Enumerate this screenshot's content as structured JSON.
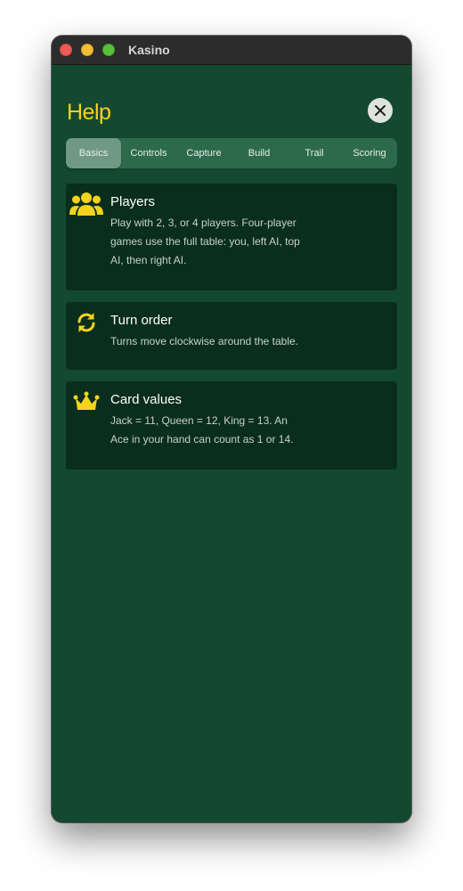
{
  "window": {
    "title": "Kasino"
  },
  "help": {
    "title": "Help",
    "close_icon": "close-icon"
  },
  "tabs": [
    {
      "label": "Basics",
      "active": true
    },
    {
      "label": "Controls",
      "active": false
    },
    {
      "label": "Capture",
      "active": false
    },
    {
      "label": "Build",
      "active": false
    },
    {
      "label": "Trail",
      "active": false
    },
    {
      "label": "Scoring",
      "active": false
    }
  ],
  "cards": [
    {
      "icon": "players-icon",
      "title": "Players",
      "text": "Play with 2, 3, or 4 players. Four-player games use the full table: you, left AI, top AI, then right AI."
    },
    {
      "icon": "turn-order-icon",
      "title": "Turn order",
      "text": "Turns move clockwise around the table."
    },
    {
      "icon": "crown-icon",
      "title": "Card values",
      "text": "Jack = 11, Queen = 12, King = 13. An Ace in your hand can count as 1 or 14."
    }
  ],
  "colors": {
    "background": "#134930",
    "accent": "#f4d31c",
    "card": "#092e1d",
    "tab_bar": "#2d6a4c",
    "tab_active": "#6f9984"
  }
}
